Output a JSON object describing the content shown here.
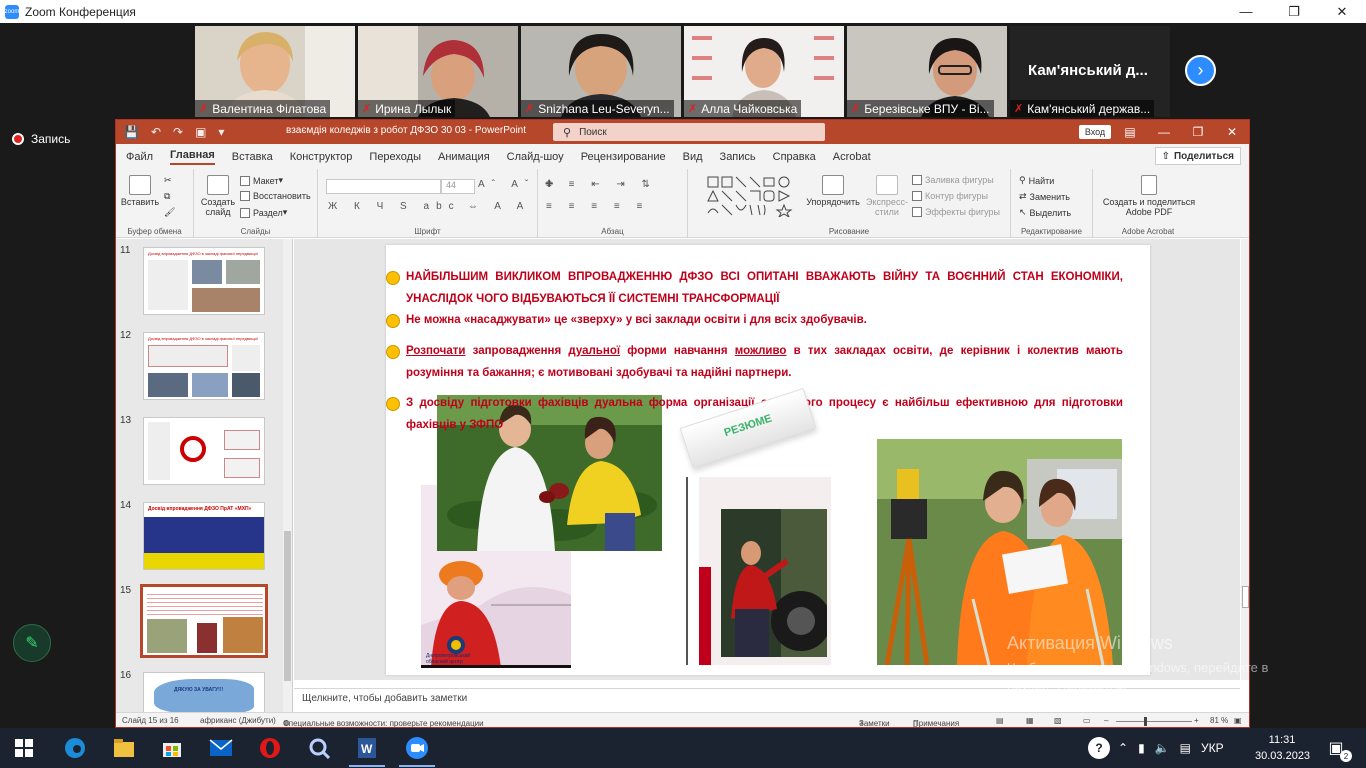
{
  "zoom": {
    "title": "Zoom Конференция",
    "record_label": "Запись",
    "participants": [
      {
        "name": "Валентина Філатова"
      },
      {
        "name": "Ирина Лылык"
      },
      {
        "name": "Snizhana Leu-Severyn..."
      },
      {
        "name": "Алла Чайковська"
      },
      {
        "name": "Березівське ВПУ - Ві..."
      },
      {
        "name": "Кам'янський держав...",
        "big_name": "Кам'янський д..."
      }
    ]
  },
  "ppt": {
    "doc_title": "взаємдія коледжів з робот ДФЗО 30 03  -  PowerPoint",
    "search_placeholder": "Поиск",
    "login": "Вход",
    "share": "Поделиться",
    "menu": [
      "Файл",
      "Главная",
      "Вставка",
      "Конструктор",
      "Переходы",
      "Анимация",
      "Слайд-шоу",
      "Рецензирование",
      "Вид",
      "Запись",
      "Справка",
      "Acrobat"
    ],
    "ribbon": {
      "clipboard": {
        "paste": "Вставить",
        "label": "Буфер обмена"
      },
      "slides": {
        "create": "Создать слайд",
        "layout": "Макет",
        "restore": "Восстановить",
        "section": "Раздел",
        "label": "Слайды"
      },
      "font": {
        "label": "Шрифт",
        "size": "44"
      },
      "paragraph": {
        "label": "Абзац"
      },
      "drawing": {
        "arrange": "Упорядочить",
        "styles": "Экспресс-стили",
        "fill": "Заливка фигуры",
        "outline": "Контур фигуры",
        "effects": "Эффекты фигуры",
        "label": "Рисование"
      },
      "editing": {
        "find": "Найти",
        "replace": "Заменить",
        "select": "Выделить",
        "label": "Редактирование"
      },
      "acrobat": {
        "create": "Создать и поделиться Adobe PDF",
        "label": "Adobe Acrobat"
      }
    },
    "thumbs": [
      {
        "num": "11",
        "title": "Досвід впровадження ДФЗО в закладі фахової передвищої освіти"
      },
      {
        "num": "12",
        "title": "Досвід впровадження ДФЗО в закладі фахової передвищої освіти"
      },
      {
        "num": "13",
        "title": ""
      },
      {
        "num": "14",
        "title": "Досвід впровадження ДФЗО ПрАТ «МХП»"
      },
      {
        "num": "15",
        "title": ""
      },
      {
        "num": "16",
        "title": "ДЯКУЮ ЗА УВАГУ!!!"
      }
    ],
    "slide": {
      "b1": "Найбільшим викликом впровадженню ДФЗО всі опитані вважають війну та воєнний стан економіки, унаслідок чого відбуваються її системні трансформації",
      "b2": "Не можна «насаджувати» це «зверху» у всі заклади освіти і для всіх здобувачів.",
      "b3_a": "Розпочати",
      "b3_b": " запровадження ",
      "b3_c": "дуальної",
      "b3_d": " форми навчання ",
      "b3_e": "можливо",
      "b3_f": " в тих закладах освіти, де керівник і колектив мають розуміння та бажання; є мотивовані здобувачі та надійні партнери.",
      "b4": "З досвіду підготовки фахівців дуальна форма організації освітнього процесу є найбільш ефективною для підготовки фахівців у ЗФПО",
      "tag": "РЕЗЮМЕ",
      "logo_text": "Дніпропетровський обласний центр зайнятості"
    },
    "notes_placeholder": "Щелкните, чтобы добавить заметки",
    "status": {
      "slide": "Слайд 15 из 16",
      "lang": "африканс (Джибути)",
      "access": "Специальные возможности: проверьте рекомендации",
      "notes": "Заметки",
      "comments": "Примечания",
      "zoom": "81 %"
    }
  },
  "watermark": {
    "line1": "Активация Windows",
    "line2": "Чтобы активировать Windows, перейдите в",
    "line3": "раздел \"Параметры\"."
  },
  "taskbar": {
    "lang": "УКР",
    "time": "11:31",
    "date": "30.03.2023",
    "notif_count": "2"
  }
}
